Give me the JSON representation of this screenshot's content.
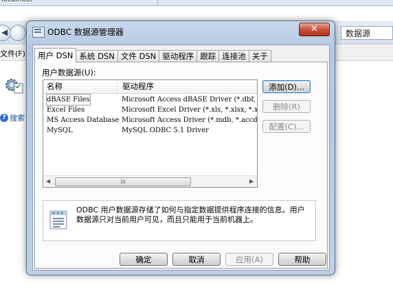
{
  "background": {
    "top_text": "localhost",
    "search_box": "数据源",
    "menu_file": "文件(F)",
    "search_link": "搜索"
  },
  "dialog": {
    "title": "ODBC 数据源管理器",
    "close_glyph": "✕",
    "tabs": [
      {
        "label": "用户 DSN",
        "active": true
      },
      {
        "label": "系统 DSN"
      },
      {
        "label": "文件 DSN"
      },
      {
        "label": "驱动程序"
      },
      {
        "label": "跟踪"
      },
      {
        "label": "连接池"
      },
      {
        "label": "关于"
      }
    ],
    "list_label": "用户数据源(U):",
    "columns": [
      "名称",
      "驱动程序"
    ],
    "rows": [
      {
        "name": "dBASE Files",
        "driver": "Microsoft Access dBASE Driver (*.dbf, *.ndx"
      },
      {
        "name": "Excel Files",
        "driver": "Microsoft Excel Driver (*.xls, *.xlsx, *.xlsm"
      },
      {
        "name": "MS Access Database",
        "driver": "Microsoft Access Driver (*.mdb, *.accdb)"
      },
      {
        "name": "MySQL",
        "driver": "MySQL ODBC 5.1 Driver"
      }
    ],
    "scroll_grip": "III",
    "side_buttons": {
      "add": "添加(D)...",
      "remove": "删除(R)",
      "configure": "配置(C)..."
    },
    "info_text": "ODBC 用户数据源存储了如何与指定数据提供程序连接的信息。用户数据源只对当前用户可见，而且只能用于当前机器上。",
    "footer_buttons": {
      "ok": "确定",
      "cancel": "取消",
      "apply": "应用(A)",
      "help": "帮助"
    }
  }
}
